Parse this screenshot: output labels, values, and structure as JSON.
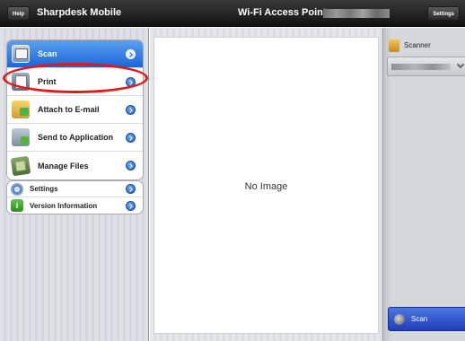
{
  "topbar": {
    "help_label": "Help",
    "app_title": "Sharpdesk Mobile",
    "wifi_label": "Wi-Fi Access Point:",
    "settings_label": "Settings"
  },
  "sidebar": {
    "main_items": [
      {
        "label": "Scan",
        "icon": "scan-icon",
        "selected": true
      },
      {
        "label": "Print",
        "icon": "print-icon"
      },
      {
        "label": "Attach to E-mail",
        "icon": "mail-icon"
      },
      {
        "label": "Send to Application",
        "icon": "send-app-icon"
      },
      {
        "label": "Manage Files",
        "icon": "manage-files-icon"
      }
    ],
    "secondary_items": [
      {
        "label": "Settings",
        "icon": "settings-icon"
      },
      {
        "label": "Version Information",
        "icon": "info-icon"
      }
    ]
  },
  "main": {
    "no_image_text": "No Image"
  },
  "right_panel": {
    "scanner_label": "Scanner",
    "scan_button_label": "Scan"
  },
  "colors": {
    "selected_item": "#1a66d8",
    "annotation": "#e01a1a",
    "scan_button": "#2b4fd0"
  }
}
